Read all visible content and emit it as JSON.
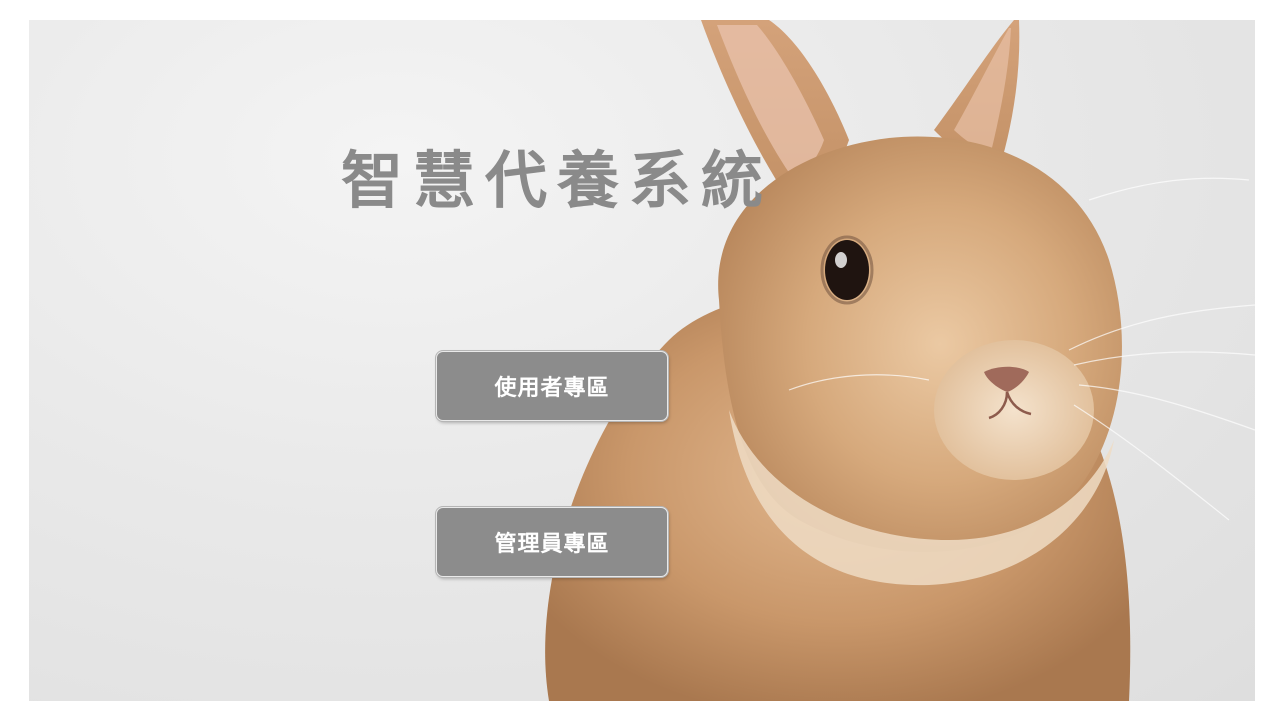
{
  "title": "智慧代養系統",
  "buttons": {
    "user_zone": "使用者專區",
    "admin_zone": "管理員專區"
  },
  "illustration": {
    "subject": "rabbit-photo",
    "fur_color": "#c9976a"
  },
  "colors": {
    "title": "#8a8a8a",
    "button_bg": "#8c8c8c",
    "button_text": "#ffffff",
    "background": "#e6e6e6"
  }
}
